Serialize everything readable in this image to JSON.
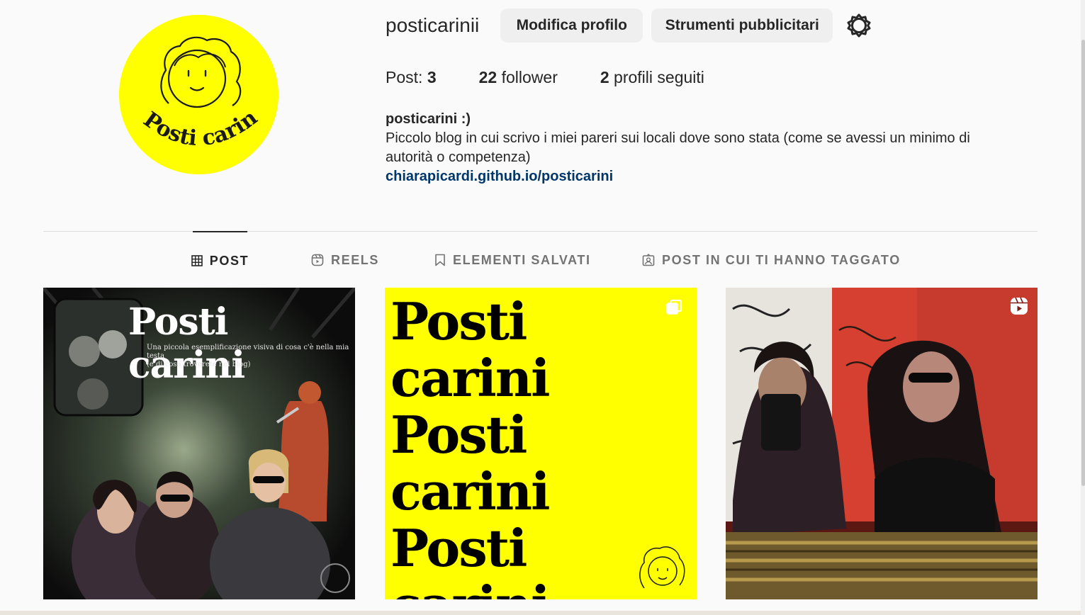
{
  "profile": {
    "username": "posticarinii",
    "edit_label": "Modifica profilo",
    "ads_label": "Strumenti pubblicitari",
    "avatar_text": "Posti carini"
  },
  "stats": {
    "posts_label": "Post:",
    "posts_count": "3",
    "followers_count": "22",
    "followers_label": "follower",
    "following_count": "2",
    "following_label": "profili seguiti"
  },
  "bio": {
    "name": "posticarini :)",
    "text": "Piccolo blog in cui scrivo i miei pareri sui locali dove sono stata (come se avessi un minimo di autorità o competenza)",
    "link": "chiarapicardi.github.io/posticarini"
  },
  "tabs": [
    {
      "label": "POST",
      "icon": "grid-icon"
    },
    {
      "label": "REELS",
      "icon": "reels-icon"
    },
    {
      "label": "ELEMENTI SALVATI",
      "icon": "bookmark-icon"
    },
    {
      "label": "POST IN CUI TI HANNO TAGGATO",
      "icon": "tagged-icon"
    }
  ],
  "posts": [
    {
      "title": "Posti carini",
      "subtitle_1": "Una piccola esemplificazione visiva di cosa c'è nella mia testa",
      "subtitle_2": "(e di cosa troverete nel blog)"
    },
    {
      "lines": [
        "Posti carini",
        "Posti carini",
        "Posti carini"
      ],
      "badge": "multiple-images-icon"
    },
    {
      "badge": "reel-icon"
    }
  ],
  "colors": {
    "brand_yellow": "#ffff00",
    "button_bg": "#efefef",
    "link": "#00376b",
    "background": "#fafafa"
  }
}
